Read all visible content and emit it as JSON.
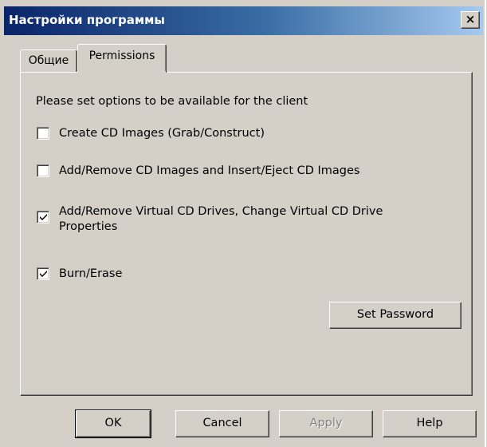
{
  "window": {
    "title": "Настройки программы",
    "close_label": "×"
  },
  "tabs": [
    {
      "label": "Общие",
      "active": false
    },
    {
      "label": "Permissions",
      "active": true
    }
  ],
  "permissions": {
    "intro": "Please set options to be available for the client",
    "options": [
      {
        "label": "Create CD Images (Grab/Construct)",
        "checked": false
      },
      {
        "label": "Add/Remove CD Images and Insert/Eject CD Images",
        "checked": false
      },
      {
        "label_line1": "Add/Remove Virtual CD Drives, Change Virtual CD Drive",
        "label_line2": "Properties",
        "checked": true
      },
      {
        "label": "Burn/Erase",
        "checked": true
      }
    ],
    "set_password_label": "Set Password"
  },
  "footer": {
    "ok_label": "OK",
    "cancel_label": "Cancel",
    "apply_label": "Apply",
    "help_label": "Help"
  },
  "icons": {
    "close": "close-icon",
    "check": "checkmark-icon"
  }
}
